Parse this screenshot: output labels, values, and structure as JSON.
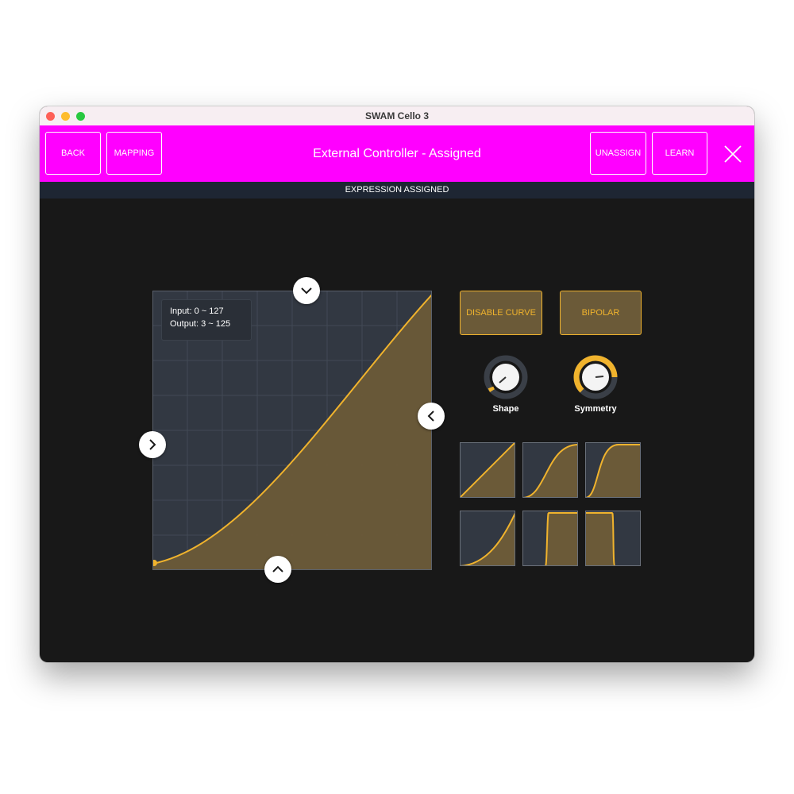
{
  "window": {
    "title": "SWAM Cello 3"
  },
  "toolbar": {
    "back_label": "BACK",
    "mapping_label": "MAPPING",
    "title": "External Controller - Assigned",
    "unassign_label": "UNASSIGN",
    "learn_label": "LEARN"
  },
  "status": {
    "text": "EXPRESSION ASSIGNED"
  },
  "curve": {
    "input_text": "Input: 0 ~ 127",
    "output_text": "Output: 3 ~ 125",
    "input_range": [
      0,
      127
    ],
    "output_range": [
      3,
      125
    ]
  },
  "controls": {
    "disable_curve_label": "DISABLE CURVE",
    "bipolar_label": "BIPOLAR",
    "shape_label": "Shape",
    "symmetry_label": "Symmetry"
  },
  "presets": [
    "linear",
    "s-curve",
    "s-curve-early",
    "exponential",
    "step-early",
    "step-late"
  ],
  "colors": {
    "accent": "#ff00ff",
    "curve": "#f0b32d",
    "fill": "#6b5a38",
    "grid_bg": "#323842",
    "background": "#181818",
    "statusbar": "#1e2633"
  },
  "icons": {
    "top_handle": "chevron-down-icon",
    "bottom_handle": "chevron-up-icon",
    "left_handle": "chevron-right-icon",
    "right_handle": "chevron-left-icon",
    "close": "close-icon"
  }
}
